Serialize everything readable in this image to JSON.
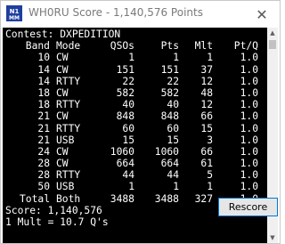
{
  "window": {
    "title": "WH0RU Score - 1,140,576 Points",
    "close_glyph": "✕"
  },
  "score": {
    "contest_line": "Contest: DXPEDITION",
    "headers": {
      "band": "Band",
      "mode": "Mode",
      "qsos": "QSOs",
      "pts": "Pts",
      "mlt": "Mlt",
      "ptq": "Pt/Q"
    },
    "rows": [
      {
        "band": "10",
        "mode": "CW",
        "qsos": "1",
        "pts": "1",
        "mlt": "1",
        "ptq": "1.0"
      },
      {
        "band": "14",
        "mode": "CW",
        "qsos": "151",
        "pts": "151",
        "mlt": "37",
        "ptq": "1.0"
      },
      {
        "band": "14",
        "mode": "RTTY",
        "qsos": "22",
        "pts": "22",
        "mlt": "12",
        "ptq": "1.0"
      },
      {
        "band": "18",
        "mode": "CW",
        "qsos": "582",
        "pts": "582",
        "mlt": "48",
        "ptq": "1.0"
      },
      {
        "band": "18",
        "mode": "RTTY",
        "qsos": "40",
        "pts": "40",
        "mlt": "12",
        "ptq": "1.0"
      },
      {
        "band": "21",
        "mode": "CW",
        "qsos": "848",
        "pts": "848",
        "mlt": "66",
        "ptq": "1.0"
      },
      {
        "band": "21",
        "mode": "RTTY",
        "qsos": "60",
        "pts": "60",
        "mlt": "15",
        "ptq": "1.0"
      },
      {
        "band": "21",
        "mode": "USB",
        "qsos": "15",
        "pts": "15",
        "mlt": "3",
        "ptq": "1.0"
      },
      {
        "band": "24",
        "mode": "CW",
        "qsos": "1060",
        "pts": "1060",
        "mlt": "66",
        "ptq": "1.0"
      },
      {
        "band": "28",
        "mode": "CW",
        "qsos": "664",
        "pts": "664",
        "mlt": "61",
        "ptq": "1.0"
      },
      {
        "band": "28",
        "mode": "RTTY",
        "qsos": "44",
        "pts": "44",
        "mlt": "5",
        "ptq": "1.0"
      },
      {
        "band": "50",
        "mode": "USB",
        "qsos": "1",
        "pts": "1",
        "mlt": "1",
        "ptq": "1.0"
      }
    ],
    "total": {
      "band": "Total",
      "mode": "Both",
      "qsos": "3488",
      "pts": "3488",
      "mlt": "327",
      "ptq": "1.0"
    },
    "score_line": "Score: 1,140,576",
    "mult_line": "1 Mult = 10.7 Q's"
  },
  "scrollbar": {
    "up_glyph": "▲",
    "down_glyph": "▼"
  },
  "buttons": {
    "rescore_label": "Rescore"
  },
  "colors": {
    "panel_bg": "#000000",
    "panel_text": "#ffffff",
    "accent": "#0078d7",
    "logo_blue": "#1f3f9f"
  }
}
